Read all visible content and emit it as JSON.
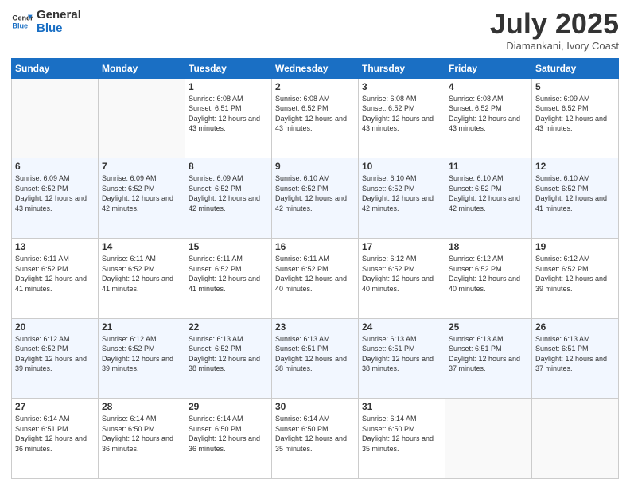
{
  "logo": {
    "text_general": "General",
    "text_blue": "Blue"
  },
  "header": {
    "month": "July 2025",
    "location": "Diamankani, Ivory Coast"
  },
  "weekdays": [
    "Sunday",
    "Monday",
    "Tuesday",
    "Wednesday",
    "Thursday",
    "Friday",
    "Saturday"
  ],
  "weeks": [
    [
      {
        "day": "",
        "sunrise": "",
        "sunset": "",
        "daylight": ""
      },
      {
        "day": "",
        "sunrise": "",
        "sunset": "",
        "daylight": ""
      },
      {
        "day": "1",
        "sunrise": "Sunrise: 6:08 AM",
        "sunset": "Sunset: 6:51 PM",
        "daylight": "Daylight: 12 hours and 43 minutes."
      },
      {
        "day": "2",
        "sunrise": "Sunrise: 6:08 AM",
        "sunset": "Sunset: 6:52 PM",
        "daylight": "Daylight: 12 hours and 43 minutes."
      },
      {
        "day": "3",
        "sunrise": "Sunrise: 6:08 AM",
        "sunset": "Sunset: 6:52 PM",
        "daylight": "Daylight: 12 hours and 43 minutes."
      },
      {
        "day": "4",
        "sunrise": "Sunrise: 6:08 AM",
        "sunset": "Sunset: 6:52 PM",
        "daylight": "Daylight: 12 hours and 43 minutes."
      },
      {
        "day": "5",
        "sunrise": "Sunrise: 6:09 AM",
        "sunset": "Sunset: 6:52 PM",
        "daylight": "Daylight: 12 hours and 43 minutes."
      }
    ],
    [
      {
        "day": "6",
        "sunrise": "Sunrise: 6:09 AM",
        "sunset": "Sunset: 6:52 PM",
        "daylight": "Daylight: 12 hours and 43 minutes."
      },
      {
        "day": "7",
        "sunrise": "Sunrise: 6:09 AM",
        "sunset": "Sunset: 6:52 PM",
        "daylight": "Daylight: 12 hours and 42 minutes."
      },
      {
        "day": "8",
        "sunrise": "Sunrise: 6:09 AM",
        "sunset": "Sunset: 6:52 PM",
        "daylight": "Daylight: 12 hours and 42 minutes."
      },
      {
        "day": "9",
        "sunrise": "Sunrise: 6:10 AM",
        "sunset": "Sunset: 6:52 PM",
        "daylight": "Daylight: 12 hours and 42 minutes."
      },
      {
        "day": "10",
        "sunrise": "Sunrise: 6:10 AM",
        "sunset": "Sunset: 6:52 PM",
        "daylight": "Daylight: 12 hours and 42 minutes."
      },
      {
        "day": "11",
        "sunrise": "Sunrise: 6:10 AM",
        "sunset": "Sunset: 6:52 PM",
        "daylight": "Daylight: 12 hours and 42 minutes."
      },
      {
        "day": "12",
        "sunrise": "Sunrise: 6:10 AM",
        "sunset": "Sunset: 6:52 PM",
        "daylight": "Daylight: 12 hours and 41 minutes."
      }
    ],
    [
      {
        "day": "13",
        "sunrise": "Sunrise: 6:11 AM",
        "sunset": "Sunset: 6:52 PM",
        "daylight": "Daylight: 12 hours and 41 minutes."
      },
      {
        "day": "14",
        "sunrise": "Sunrise: 6:11 AM",
        "sunset": "Sunset: 6:52 PM",
        "daylight": "Daylight: 12 hours and 41 minutes."
      },
      {
        "day": "15",
        "sunrise": "Sunrise: 6:11 AM",
        "sunset": "Sunset: 6:52 PM",
        "daylight": "Daylight: 12 hours and 41 minutes."
      },
      {
        "day": "16",
        "sunrise": "Sunrise: 6:11 AM",
        "sunset": "Sunset: 6:52 PM",
        "daylight": "Daylight: 12 hours and 40 minutes."
      },
      {
        "day": "17",
        "sunrise": "Sunrise: 6:12 AM",
        "sunset": "Sunset: 6:52 PM",
        "daylight": "Daylight: 12 hours and 40 minutes."
      },
      {
        "day": "18",
        "sunrise": "Sunrise: 6:12 AM",
        "sunset": "Sunset: 6:52 PM",
        "daylight": "Daylight: 12 hours and 40 minutes."
      },
      {
        "day": "19",
        "sunrise": "Sunrise: 6:12 AM",
        "sunset": "Sunset: 6:52 PM",
        "daylight": "Daylight: 12 hours and 39 minutes."
      }
    ],
    [
      {
        "day": "20",
        "sunrise": "Sunrise: 6:12 AM",
        "sunset": "Sunset: 6:52 PM",
        "daylight": "Daylight: 12 hours and 39 minutes."
      },
      {
        "day": "21",
        "sunrise": "Sunrise: 6:12 AM",
        "sunset": "Sunset: 6:52 PM",
        "daylight": "Daylight: 12 hours and 39 minutes."
      },
      {
        "day": "22",
        "sunrise": "Sunrise: 6:13 AM",
        "sunset": "Sunset: 6:52 PM",
        "daylight": "Daylight: 12 hours and 38 minutes."
      },
      {
        "day": "23",
        "sunrise": "Sunrise: 6:13 AM",
        "sunset": "Sunset: 6:51 PM",
        "daylight": "Daylight: 12 hours and 38 minutes."
      },
      {
        "day": "24",
        "sunrise": "Sunrise: 6:13 AM",
        "sunset": "Sunset: 6:51 PM",
        "daylight": "Daylight: 12 hours and 38 minutes."
      },
      {
        "day": "25",
        "sunrise": "Sunrise: 6:13 AM",
        "sunset": "Sunset: 6:51 PM",
        "daylight": "Daylight: 12 hours and 37 minutes."
      },
      {
        "day": "26",
        "sunrise": "Sunrise: 6:13 AM",
        "sunset": "Sunset: 6:51 PM",
        "daylight": "Daylight: 12 hours and 37 minutes."
      }
    ],
    [
      {
        "day": "27",
        "sunrise": "Sunrise: 6:14 AM",
        "sunset": "Sunset: 6:51 PM",
        "daylight": "Daylight: 12 hours and 36 minutes."
      },
      {
        "day": "28",
        "sunrise": "Sunrise: 6:14 AM",
        "sunset": "Sunset: 6:50 PM",
        "daylight": "Daylight: 12 hours and 36 minutes."
      },
      {
        "day": "29",
        "sunrise": "Sunrise: 6:14 AM",
        "sunset": "Sunset: 6:50 PM",
        "daylight": "Daylight: 12 hours and 36 minutes."
      },
      {
        "day": "30",
        "sunrise": "Sunrise: 6:14 AM",
        "sunset": "Sunset: 6:50 PM",
        "daylight": "Daylight: 12 hours and 35 minutes."
      },
      {
        "day": "31",
        "sunrise": "Sunrise: 6:14 AM",
        "sunset": "Sunset: 6:50 PM",
        "daylight": "Daylight: 12 hours and 35 minutes."
      },
      {
        "day": "",
        "sunrise": "",
        "sunset": "",
        "daylight": ""
      },
      {
        "day": "",
        "sunrise": "",
        "sunset": "",
        "daylight": ""
      }
    ]
  ]
}
